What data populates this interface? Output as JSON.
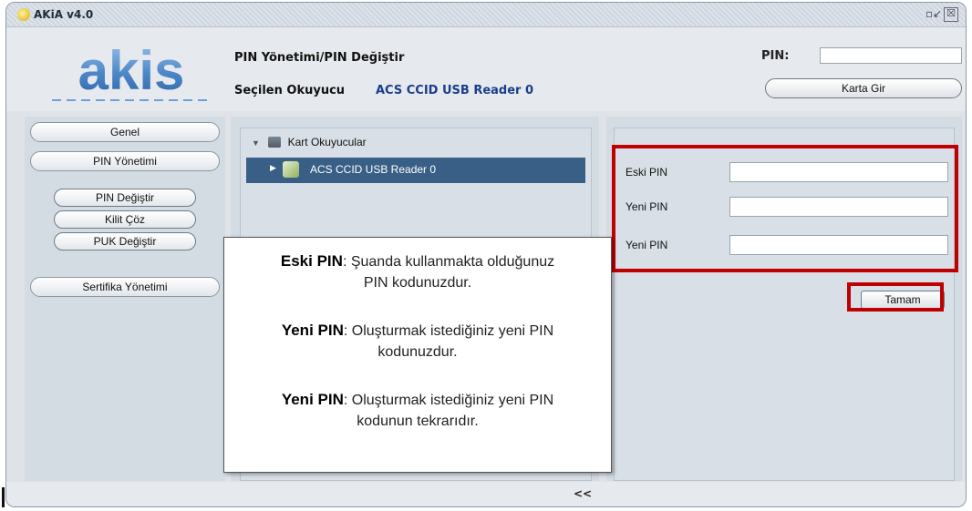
{
  "window": {
    "title": "AKiA v4.0",
    "restore_glyph": "▫↙",
    "close_glyph": "☒"
  },
  "logo": {
    "text": "akis",
    "color": "#4c86c8"
  },
  "header": {
    "page_title": "PIN Yönetimi/PIN Değiştir",
    "reader_label": "Seçilen Okuyucu",
    "reader_value": "ACS CCID USB Reader 0",
    "pin_label": "PIN:",
    "pin_value": "",
    "karta_gir_label": "Karta Gir"
  },
  "sidebar": {
    "genel": "Genel",
    "pin_yonetimi": "PIN Yönetimi",
    "sub_items": [
      "PIN Değiştir",
      "Kilit Çöz",
      "PUK Değiştir"
    ],
    "sertifika": "Sertifika Yönetimi"
  },
  "tree": {
    "root_label": "Kart Okuyucular",
    "child_label": "ACS CCID USB Reader 0"
  },
  "form": {
    "fields": [
      {
        "label": "Eski PIN",
        "value": ""
      },
      {
        "label": "Yeni PIN",
        "value": ""
      },
      {
        "label": "Yeni PIN",
        "value": ""
      }
    ],
    "submit_label": "Tamam"
  },
  "tooltip": {
    "items": [
      {
        "term": "Eski PIN",
        "sep": ":",
        "line1": " Şuanda kullanmakta olduğunuz",
        "line2": "PIN kodunuzdur."
      },
      {
        "term": "Yeni PIN",
        "sep": ":",
        "line1": " Oluşturmak istediğiniz yeni PIN",
        "line2": "kodunuzdur."
      },
      {
        "term": "Yeni PIN",
        "sep": ":",
        "line1": " Oluşturmak istediğiniz yeni PIN",
        "line2": "kodunun tekrarıdır."
      }
    ]
  },
  "footer": {
    "collapse_label": "<<"
  },
  "colors": {
    "highlight": "#c00000",
    "selection": "#395f86",
    "accent_text": "#1a3e8c"
  }
}
